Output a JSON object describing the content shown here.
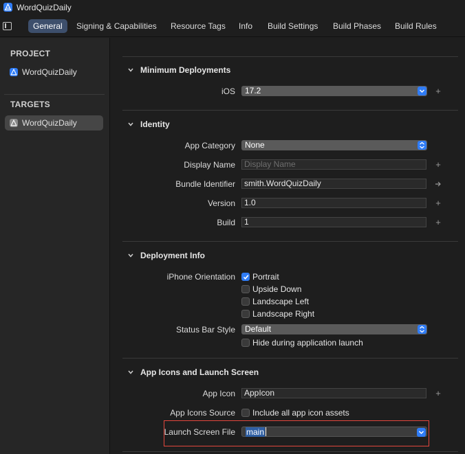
{
  "window": {
    "title": "WordQuizDaily"
  },
  "tabs": [
    {
      "label": "General",
      "active": true
    },
    {
      "label": "Signing & Capabilities"
    },
    {
      "label": "Resource Tags"
    },
    {
      "label": "Info"
    },
    {
      "label": "Build Settings"
    },
    {
      "label": "Build Phases"
    },
    {
      "label": "Build Rules"
    }
  ],
  "sidebar": {
    "project_header": "PROJECT",
    "project_item": "WordQuizDaily",
    "targets_header": "TARGETS",
    "target_item": "WordQuizDaily"
  },
  "sections": {
    "min_deploy": {
      "title": "Minimum Deployments",
      "ios_label": "iOS",
      "ios_value": "17.2"
    },
    "identity": {
      "title": "Identity",
      "app_category_label": "App Category",
      "app_category_value": "None",
      "display_name_label": "Display Name",
      "display_name_placeholder": "Display Name",
      "bundle_id_label": "Bundle Identifier",
      "bundle_id_value": "smith.WordQuizDaily",
      "version_label": "Version",
      "version_value": "1.0",
      "build_label": "Build",
      "build_value": "1"
    },
    "deployment": {
      "title": "Deployment Info",
      "orientation_label": "iPhone Orientation",
      "orientations": [
        {
          "label": "Portrait",
          "checked": true
        },
        {
          "label": "Upside Down",
          "checked": false
        },
        {
          "label": "Landscape Left",
          "checked": false
        },
        {
          "label": "Landscape Right",
          "checked": false
        }
      ],
      "status_bar_label": "Status Bar Style",
      "status_bar_value": "Default",
      "hide_status_label": "Hide during application launch"
    },
    "app_icons": {
      "title": "App Icons and Launch Screen",
      "app_icon_label": "App Icon",
      "app_icon_value": "AppIcon",
      "icons_source_label": "App Icons Source",
      "icons_source_checkbox": "Include all app icon assets",
      "launch_file_label": "Launch Screen File",
      "launch_file_value": "main"
    }
  },
  "colors": {
    "accent": "#2f7cf6",
    "highlight_border": "#e5473d",
    "active_tab": "#3d4f6c"
  }
}
